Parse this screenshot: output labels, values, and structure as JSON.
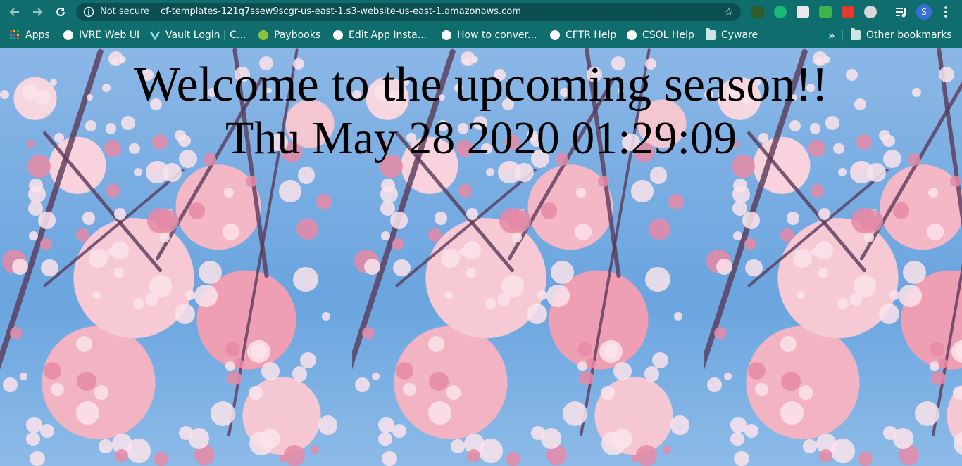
{
  "browser": {
    "omnibox": {
      "security_text": "Not secure",
      "url": "cf-templates-121q7ssew9scgr-us-east-1.s3-website-us-east-1.amazonaws.com"
    },
    "profile_initial": "S"
  },
  "bookmarks": {
    "items": [
      {
        "label": "Apps",
        "icon": "apps-grid-icon"
      },
      {
        "label": "IVRE Web UI",
        "icon": "globe-icon"
      },
      {
        "label": "Vault Login | C...",
        "icon": "vault-icon"
      },
      {
        "label": "Paybooks",
        "icon": "paybooks-icon"
      },
      {
        "label": "Edit App Insta...",
        "icon": "globe-icon"
      },
      {
        "label": "How to conver...",
        "icon": "globe-icon"
      },
      {
        "label": "CFTR Help",
        "icon": "globe-icon"
      },
      {
        "label": "CSOL Help",
        "icon": "globe-icon"
      },
      {
        "label": "Cyware",
        "icon": "folder-icon"
      }
    ],
    "overflow_label": "»",
    "other_label": "Other bookmarks"
  },
  "page": {
    "headline": "Welcome to the upcoming season!!",
    "datetime": "Thu May 28 2020 01:29:09"
  },
  "colors": {
    "chrome_bg": "#0f6d6d",
    "omnibox_bg": "#0b4f52",
    "sky": "#7fb0e0",
    "blossom_pink": "#f3b7c6"
  }
}
